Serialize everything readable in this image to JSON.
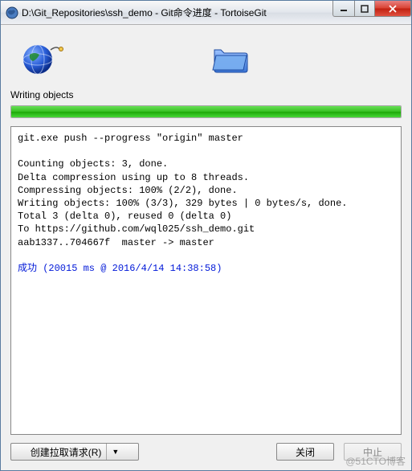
{
  "titlebar": {
    "text": "D:\\Git_Repositories\\ssh_demo - Git命令进度 - TortoiseGit"
  },
  "status": {
    "label": "Writing objects",
    "progress_pct": 100
  },
  "console": {
    "lines": [
      "git.exe push --progress \"origin\" master",
      "",
      "Counting objects: 3, done.",
      "Delta compression using up to 8 threads.",
      "Compressing objects: 100% (2/2), done.",
      "Writing objects: 100% (3/3), 329 bytes | 0 bytes/s, done.",
      "Total 3 (delta 0), reused 0 (delta 0)",
      "To https://github.com/wql025/ssh_demo.git",
      "aab1337..704667f  master -> master"
    ],
    "success_line": "成功 (20015 ms @ 2016/4/14 14:38:58)"
  },
  "buttons": {
    "create_pull": "创建拉取请求(R)",
    "close": "关闭",
    "abort": "中止"
  },
  "watermark": "@51CTO博客"
}
